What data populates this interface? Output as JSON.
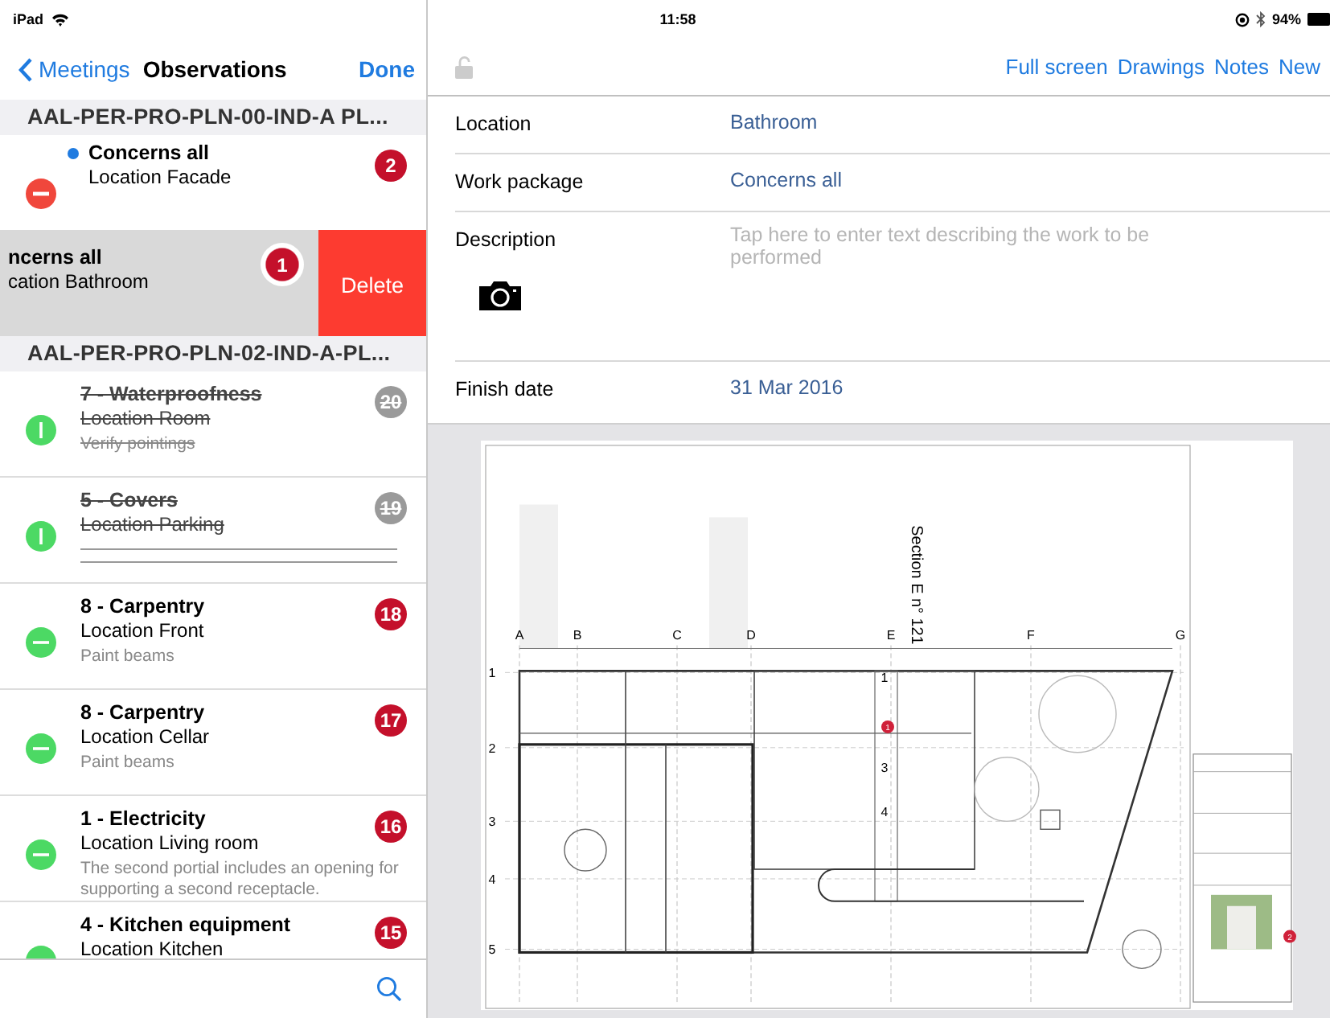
{
  "status_bar": {
    "device": "iPad",
    "time": "11:58",
    "battery": "94%"
  },
  "sidebar": {
    "back": "Meetings",
    "title": "Observations",
    "done": "Done",
    "sections": [
      {
        "title": "AAL-PER-PRO-PLN-00-IND-A PL...",
        "items": [
          {
            "kind": "editing",
            "title": "Concerns all",
            "location": "Location Facade",
            "badge": "2",
            "unread": true,
            "closed": false,
            "selected": false
          },
          {
            "kind": "swiped",
            "title": "ncerns all",
            "location": "cation Bathroom",
            "badge": "1",
            "action": "Delete",
            "selected": true
          }
        ]
      },
      {
        "title": "AAL-PER-PRO-PLN-02-IND-A-PL...",
        "items": [
          {
            "kind": "observation",
            "title": "7 - Waterproofness",
            "location": "Location Room",
            "note": "Verify pointings",
            "badge": "20",
            "unread": false,
            "closed": true,
            "selected": false
          },
          {
            "kind": "observation",
            "title": "5 - Covers",
            "location": "Location Parking",
            "badge": "19",
            "unread": false,
            "closed": true,
            "selected": false
          },
          {
            "kind": "observation",
            "title": "8 - Carpentry",
            "location": "Location Front",
            "note": "Paint beams",
            "badge": "18",
            "unread": false,
            "closed": false,
            "selected": false
          },
          {
            "kind": "observation",
            "title": "8 - Carpentry",
            "location": "Location Cellar",
            "note": "Paint beams",
            "badge": "17",
            "unread": false,
            "closed": false,
            "selected": false
          },
          {
            "kind": "observation",
            "title": "1 - Electricity",
            "location": "Location Living room",
            "note": "The second portial includes an opening for supporting a second receptacle.",
            "badge": "16",
            "unread": false,
            "closed": false,
            "selected": false
          },
          {
            "kind": "observation",
            "title": "4 - Kitchen equipment",
            "location": "Location Kitchen",
            "badge": "15",
            "unread": false,
            "closed": false,
            "selected": false
          }
        ]
      }
    ]
  },
  "toolbar": {
    "actions": [
      "Full screen",
      "Drawings",
      "Notes",
      "New"
    ]
  },
  "form": [
    {
      "kind": "value",
      "label": "Location",
      "value": "Bathroom"
    },
    {
      "kind": "value",
      "label": "Work package",
      "value": "Concerns all"
    },
    {
      "kind": "description",
      "label": "Description",
      "placeholder": "Tap here to enter text describing the work to be performed"
    },
    {
      "kind": "value",
      "label": "Finish date",
      "value": "31 Mar 2016"
    }
  ],
  "sheet": {
    "section_label": "Section E n° 121",
    "columns": [
      "A",
      "B",
      "C",
      "D",
      "E",
      "F",
      "G"
    ],
    "rows": [
      "1",
      "2",
      "3",
      "4",
      "5"
    ],
    "stairs": [
      "1",
      "3",
      "4"
    ],
    "markers": [
      "1",
      "2"
    ]
  }
}
